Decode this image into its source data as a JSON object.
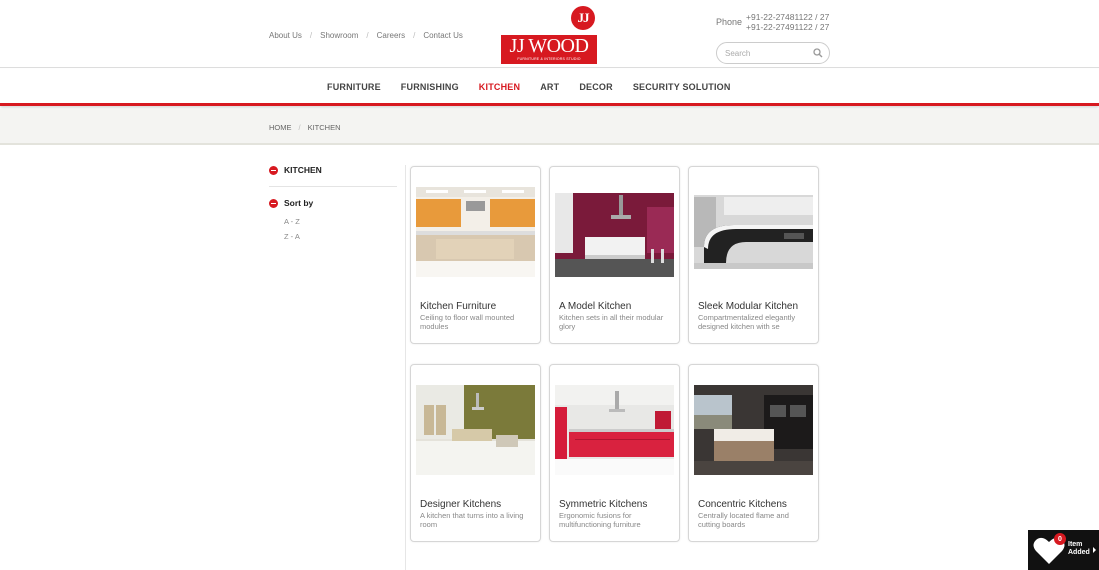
{
  "header": {
    "links": [
      "About Us",
      "Showroom",
      "Careers",
      "Contact Us"
    ],
    "logo": {
      "monogram": "JJ",
      "name": "JJ WOOD",
      "tagline": "FURNITURE & INTERIORS STUDIO"
    },
    "phone_label": "Phone",
    "phone_numbers": [
      "+91-22-27481122 / 27",
      "+91-22-27491122 / 27"
    ],
    "search_placeholder": "Search"
  },
  "nav": {
    "items": [
      "FURNITURE",
      "FURNISHING",
      "KITCHEN",
      "ART",
      "DECOR",
      "SECURITY SOLUTION"
    ],
    "active": "KITCHEN"
  },
  "breadcrumb": [
    "HOME",
    "KITCHEN"
  ],
  "sidebar": {
    "category": "KITCHEN",
    "sort_label": "Sort by",
    "sort_options": [
      "A - Z",
      "Z - A"
    ]
  },
  "products": [
    {
      "title": "Kitchen Furniture",
      "desc": "Ceiling to floor wall mounted modules"
    },
    {
      "title": "A Model Kitchen",
      "desc": "Kitchen sets in all their modular glory"
    },
    {
      "title": "Sleek Modular Kitchen",
      "desc": "Compartmentalized elegantly designed kitchen with se"
    },
    {
      "title": "Designer Kitchens",
      "desc": "A kitchen that turns into a living room"
    },
    {
      "title": "Symmetric Kitchens",
      "desc": "Ergonomic fusions for multifunctioning furniture"
    },
    {
      "title": "Concentric Kitchens",
      "desc": "Centrally located flame and cutting boards"
    }
  ],
  "cart": {
    "count": "0",
    "label_line1": "Item",
    "label_line2": "Added"
  },
  "colors": {
    "accent": "#d71920",
    "breadcrumb_bg": "#f4f4f2",
    "text": "#555555"
  }
}
